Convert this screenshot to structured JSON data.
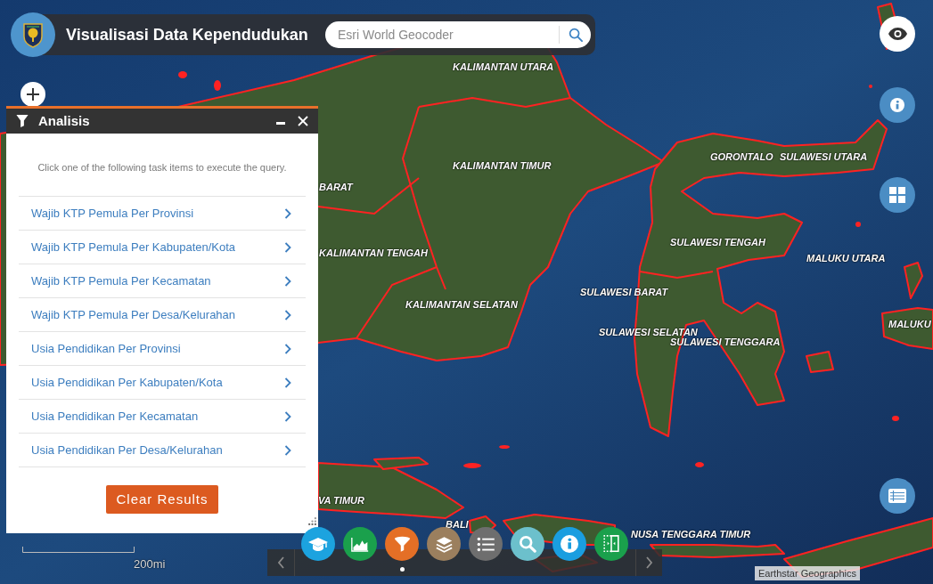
{
  "map": {
    "labels": [
      {
        "text": "KALIMANTAN UTARA"
      },
      {
        "text": "GORONTALO"
      },
      {
        "text": "SULAWESI UTARA"
      },
      {
        "text": "KALIMANTAN TIMUR"
      },
      {
        "text": "BARAT"
      },
      {
        "text": "SULAWESI TENGAH"
      },
      {
        "text": "KALIMANTAN TENGAH"
      },
      {
        "text": "MALUKU UTARA"
      },
      {
        "text": "SULAWESI BARAT"
      },
      {
        "text": "KALIMANTAN SELATAN"
      },
      {
        "text": "MALUKU"
      },
      {
        "text": "SULAWESI SELATAN"
      },
      {
        "text": "SULAWESI TENGGARA"
      },
      {
        "text": "VA TIMUR"
      },
      {
        "text": "BALI"
      },
      {
        "text": "NUSA TENGGARA TIMUR"
      }
    ]
  },
  "header": {
    "title": "Visualisasi Data Kependudukan",
    "search": {
      "placeholder": "Esri World Geocoder"
    }
  },
  "side_buttons": [
    {
      "kind": "visibility"
    },
    {
      "kind": "info"
    },
    {
      "kind": "grid"
    },
    {
      "kind": "table"
    }
  ],
  "panel": {
    "title": "Analisis",
    "description": "Click one of the following task items to execute the query.",
    "tasks": [
      "Wajib KTP Pemula Per Provinsi",
      "Wajib KTP Pemula Per Kabupaten/Kota",
      "Wajib KTP Pemula Per Kecamatan",
      "Wajib KTP Pemula Per Desa/Kelurahan",
      "Usia Pendidikan Per Provinsi",
      "Usia Pendidikan Per Kabupaten/Kota",
      "Usia Pendidikan Per Kecamatan",
      "Usia Pendidikan Per Desa/Kelurahan"
    ],
    "clear_button": "Clear Results"
  },
  "toolbar": {
    "items": [
      {
        "kind": "education",
        "color": "#1ca3df",
        "selected": false
      },
      {
        "kind": "chart",
        "color": "#1aa04c",
        "selected": false
      },
      {
        "kind": "filter",
        "color": "#e46f26",
        "selected": true
      },
      {
        "kind": "layers",
        "color": "#9b7f5e",
        "selected": false
      },
      {
        "kind": "list",
        "color": "#6e6e6e",
        "selected": false
      },
      {
        "kind": "search",
        "color": "#6cc0cc",
        "selected": false
      },
      {
        "kind": "info",
        "color": "#1a9ee0",
        "selected": false
      },
      {
        "kind": "split",
        "color": "#1aa04c",
        "selected": false
      }
    ]
  },
  "scale_bar": {
    "label": "200mi"
  },
  "attribution": "Earthstar Geographics"
}
